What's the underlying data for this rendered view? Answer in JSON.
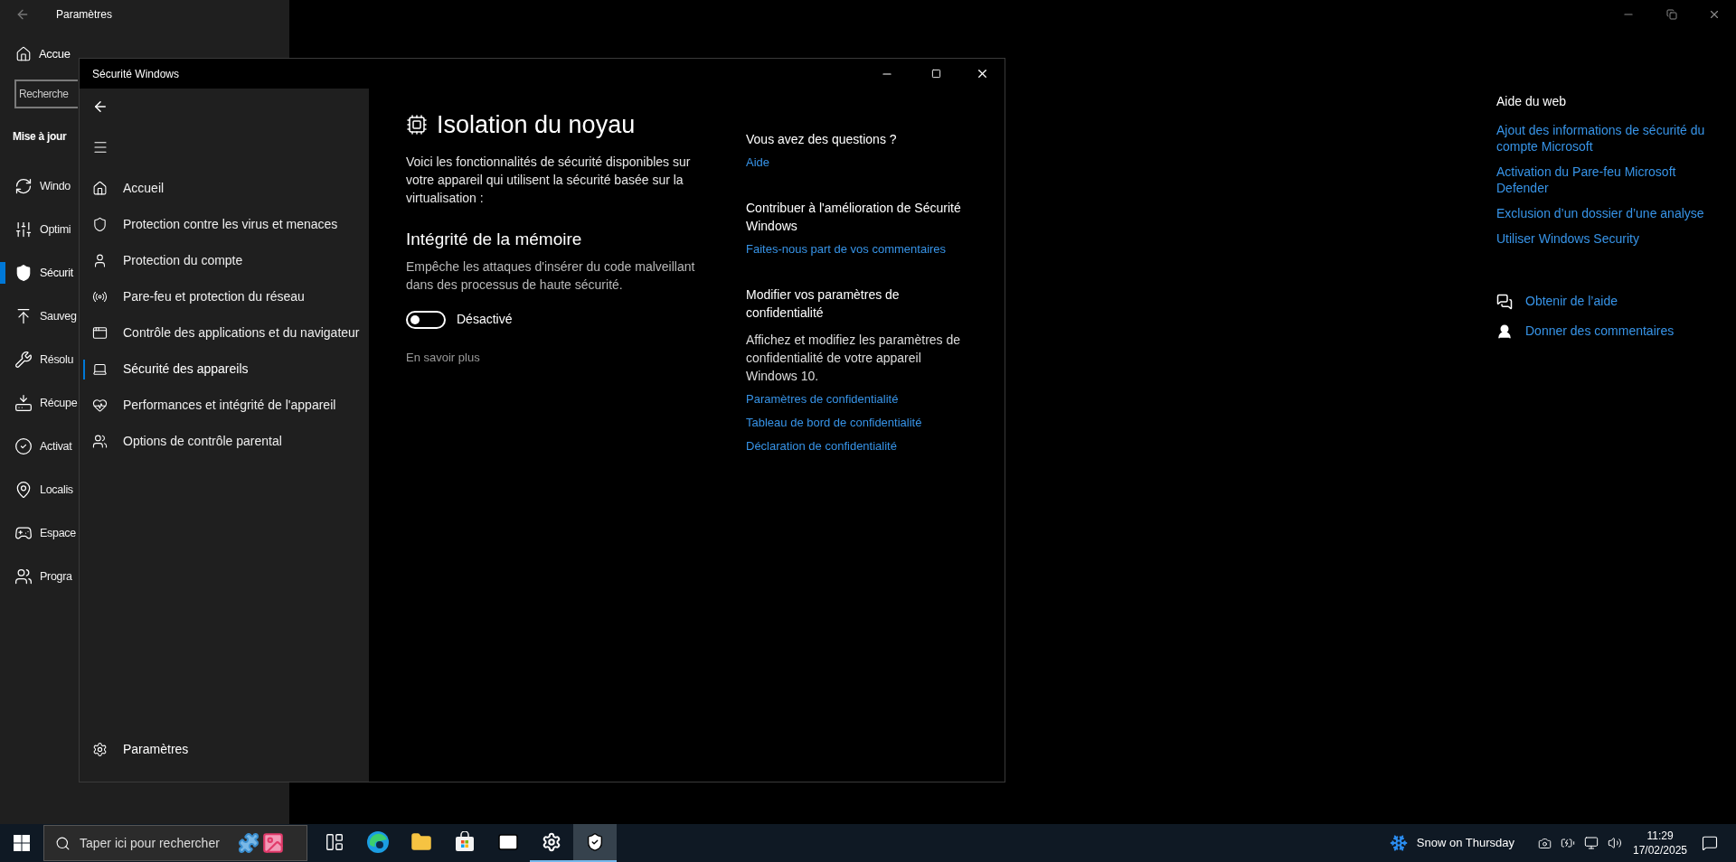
{
  "settings_window": {
    "title": "Paramètres",
    "home": "Accue",
    "search": {
      "placeholder": "Recherche"
    },
    "section_title": "Mise à jour",
    "nav_items": [
      {
        "label": "Windo",
        "selected": false
      },
      {
        "label": "Optimi",
        "selected": false
      },
      {
        "label": "Sécurit",
        "selected": true
      },
      {
        "label": "Sauveg",
        "selected": false
      },
      {
        "label": "Résolu",
        "selected": false
      },
      {
        "label": "Récupe",
        "selected": false
      },
      {
        "label": "Activat",
        "selected": false
      },
      {
        "label": "Localis",
        "selected": false
      },
      {
        "label": "Espace",
        "selected": false
      },
      {
        "label": "Progra",
        "selected": false
      }
    ],
    "web_help": {
      "title": "Aide du web",
      "links": [
        "Ajout des informations de sécurité du compte Microsoft",
        "Activation du Pare-feu Microsoft Defender",
        "Exclusion d’un dossier d’une analyse",
        "Utiliser Windows Security"
      ]
    },
    "help_actions": [
      "Obtenir de l’aide",
      "Donner des commentaires"
    ]
  },
  "security_window": {
    "title": "Sécurité Windows",
    "nav_items": [
      {
        "label": "Accueil",
        "selected": false
      },
      {
        "label": "Protection contre les virus et menaces",
        "selected": false
      },
      {
        "label": "Protection du compte",
        "selected": false
      },
      {
        "label": "Pare-feu et protection du réseau",
        "selected": false
      },
      {
        "label": "Contrôle des applications et du navigateur",
        "selected": false
      },
      {
        "label": "Sécurité des appareils",
        "selected": true
      },
      {
        "label": "Performances et intégrité de l'appareil",
        "selected": false
      },
      {
        "label": "Options de contrôle parental",
        "selected": false
      }
    ],
    "settings_item": "Paramètres",
    "page_title": "Isolation du noyau",
    "intro": "Voici les fonctionnalités de sécurité disponibles sur votre appareil qui utilisent la sécurité basée sur la virtualisation :",
    "memory_integrity": {
      "title": "Intégrité de la mémoire",
      "description": "Empêche les attaques d'insérer du code malveillant dans des processus de haute sécurité.",
      "on": false,
      "state_label": "Désactivé"
    },
    "learn_more": "En savoir plus",
    "side_sections": [
      {
        "title": "Vous avez des questions ?",
        "links": [
          "Aide"
        ]
      },
      {
        "title": "Contribuer à l'amélioration de Sécurité Windows",
        "links": [
          "Faites-nous part de vos commentaires"
        ]
      },
      {
        "title": "Modifier vos paramètres de confidentialité",
        "text": "Affichez et modifiez les paramètres de confidentialité de votre appareil Windows 10.",
        "links": [
          "Paramètres de confidentialité",
          "Tableau de bord de confidentialité",
          "Déclaration de confidentialité"
        ]
      }
    ]
  },
  "taskbar": {
    "search": {
      "placeholder": "Taper ici pour rechercher"
    },
    "apps": [
      {
        "running": false,
        "selected": false
      },
      {
        "running": false,
        "selected": false
      },
      {
        "running": false,
        "selected": false
      },
      {
        "running": false,
        "selected": false
      },
      {
        "running": false,
        "selected": false
      },
      {
        "running": true,
        "selected": false
      },
      {
        "running": true,
        "selected": true
      }
    ],
    "weather": "Snow on Thursday",
    "time": "11:29",
    "date": "17/02/2025"
  }
}
